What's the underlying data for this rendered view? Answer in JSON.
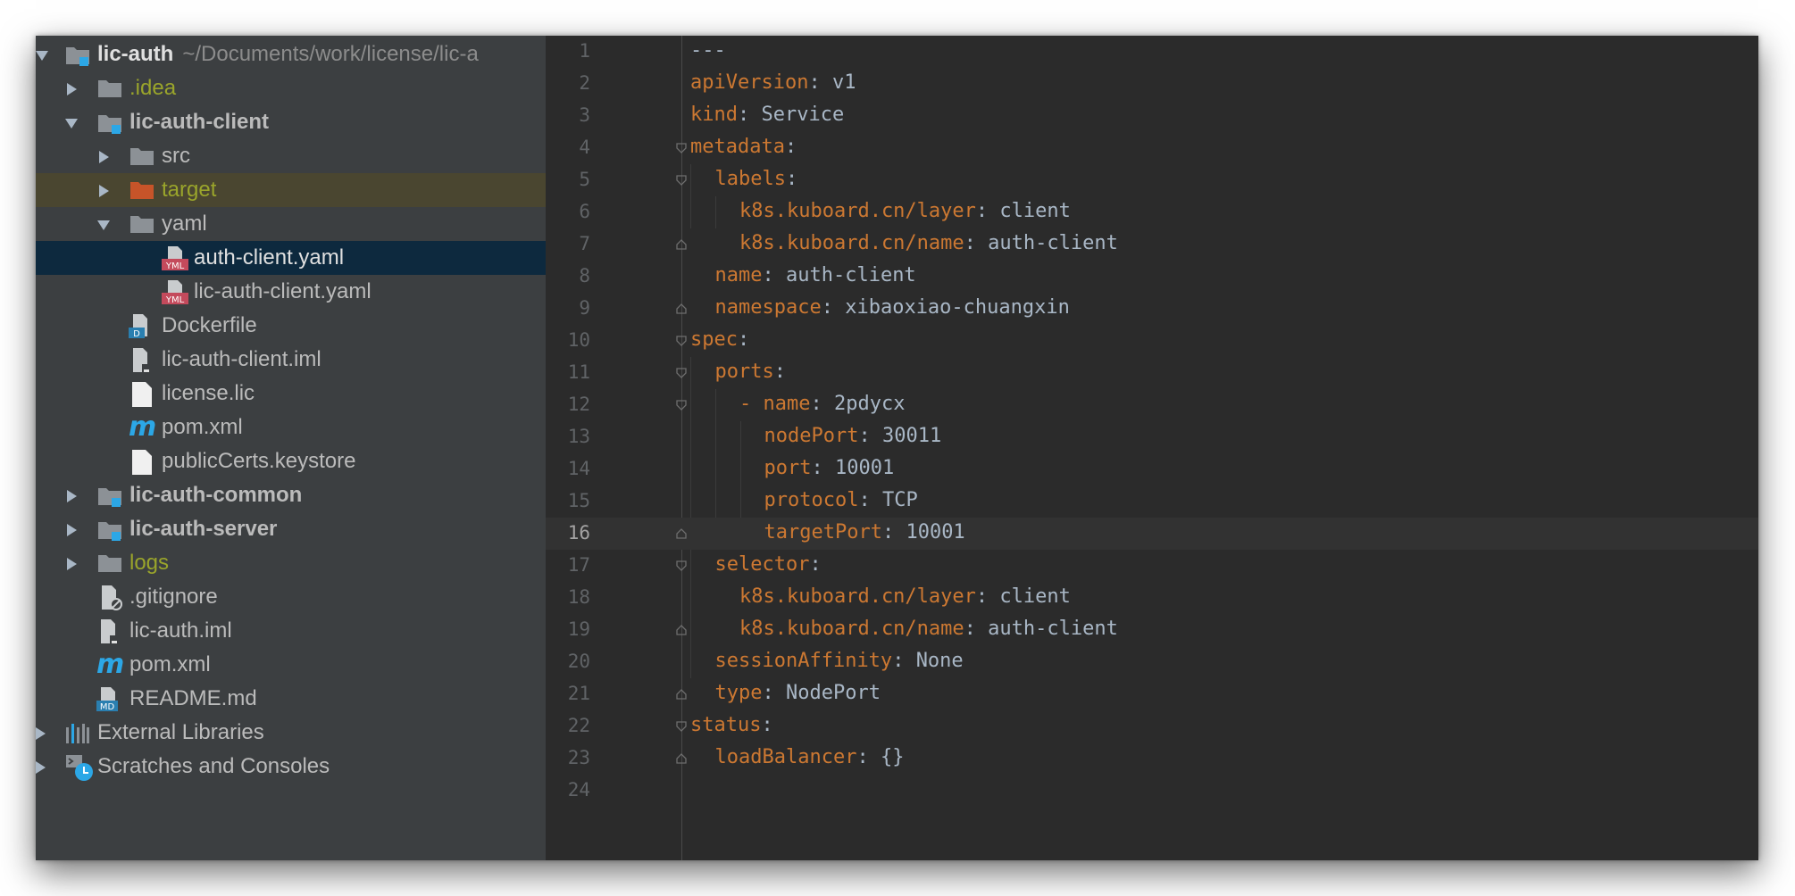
{
  "project_tree": {
    "root": {
      "name": "lic-auth",
      "path": "~/Documents/work/license/lic-a"
    },
    "items": [
      {
        "label": ".idea"
      },
      {
        "label": "lic-auth-client"
      },
      {
        "label": "src"
      },
      {
        "label": "target"
      },
      {
        "label": "yaml"
      },
      {
        "label": "auth-client.yaml"
      },
      {
        "label": "lic-auth-client.yaml"
      },
      {
        "label": "Dockerfile"
      },
      {
        "label": "lic-auth-client.iml"
      },
      {
        "label": "license.lic"
      },
      {
        "label": "pom.xml"
      },
      {
        "label": "publicCerts.keystore"
      },
      {
        "label": "lic-auth-common"
      },
      {
        "label": "lic-auth-server"
      },
      {
        "label": "logs"
      },
      {
        "label": ".gitignore"
      },
      {
        "label": "lic-auth.iml"
      },
      {
        "label": "pom.xml"
      },
      {
        "label": "README.md"
      },
      {
        "label": "External Libraries"
      },
      {
        "label": "Scratches and Consoles"
      }
    ],
    "icon_texts": {
      "yml": "YML",
      "docker": "D",
      "md": "MD",
      "maven": "m"
    }
  },
  "editor": {
    "current_line": 16,
    "lines": [
      {
        "num": "1",
        "key": "",
        "sep": "",
        "value": "---"
      },
      {
        "num": "2",
        "key": "apiVersion",
        "sep": ": ",
        "value": "v1"
      },
      {
        "num": "3",
        "key": "kind",
        "sep": ": ",
        "value": "Service"
      },
      {
        "num": "4",
        "key": "metadata",
        "sep": ":",
        "value": ""
      },
      {
        "num": "5",
        "key": "labels",
        "sep": ":",
        "value": ""
      },
      {
        "num": "6",
        "key": "k8s.kuboard.cn/layer",
        "sep": ": ",
        "value": "client"
      },
      {
        "num": "7",
        "key": "k8s.kuboard.cn/name",
        "sep": ": ",
        "value": "auth-client"
      },
      {
        "num": "8",
        "key": "name",
        "sep": ": ",
        "value": "auth-client"
      },
      {
        "num": "9",
        "key": "namespace",
        "sep": ": ",
        "value": "xibaoxiao-chuangxin"
      },
      {
        "num": "10",
        "key": "spec",
        "sep": ":",
        "value": ""
      },
      {
        "num": "11",
        "key": "ports",
        "sep": ":",
        "value": ""
      },
      {
        "num": "12",
        "key": "name",
        "sep": ": ",
        "value": "2pdycx",
        "dash": "- "
      },
      {
        "num": "13",
        "key": "nodePort",
        "sep": ": ",
        "value": "30011"
      },
      {
        "num": "14",
        "key": "port",
        "sep": ": ",
        "value": "10001"
      },
      {
        "num": "15",
        "key": "protocol",
        "sep": ": ",
        "value": "TCP"
      },
      {
        "num": "16",
        "key": "targetPort",
        "sep": ": ",
        "value": "10001"
      },
      {
        "num": "17",
        "key": "selector",
        "sep": ":",
        "value": ""
      },
      {
        "num": "18",
        "key": "k8s.kuboard.cn/layer",
        "sep": ": ",
        "value": "client"
      },
      {
        "num": "19",
        "key": "k8s.kuboard.cn/name",
        "sep": ": ",
        "value": "auth-client"
      },
      {
        "num": "20",
        "key": "sessionAffinity",
        "sep": ": ",
        "value": "None"
      },
      {
        "num": "21",
        "key": "type",
        "sep": ": ",
        "value": "NodePort"
      },
      {
        "num": "22",
        "key": "status",
        "sep": ":",
        "value": ""
      },
      {
        "num": "23",
        "key": "loadBalancer",
        "sep": ": ",
        "value": "{}"
      },
      {
        "num": "24",
        "key": "",
        "sep": "",
        "value": ""
      }
    ]
  },
  "colors": {
    "tree_bg": "#3c3f41",
    "editor_bg": "#2b2b2b",
    "selection": "#0d293e",
    "yaml_key": "#cc7832",
    "text": "#a9b7c6",
    "excluded_folder": "#c75429",
    "module_badge": "#2ca7e6"
  }
}
